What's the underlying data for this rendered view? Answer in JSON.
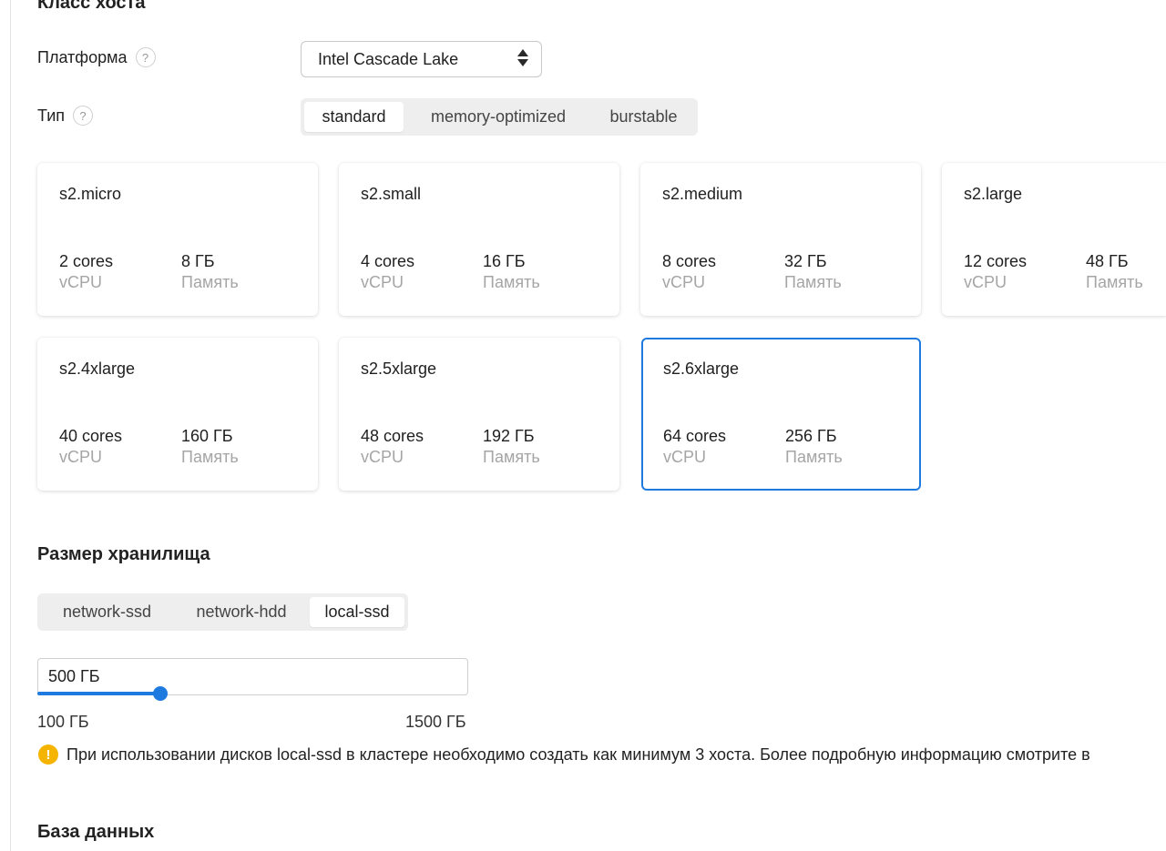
{
  "host_class": {
    "title": "Класс хоста",
    "platform": {
      "label": "Платформа",
      "help": "?",
      "value": "Intel Cascade Lake"
    },
    "type": {
      "label": "Тип",
      "help": "?",
      "options": [
        "standard",
        "memory-optimized",
        "burstable"
      ],
      "selected": "standard"
    },
    "cards": [
      {
        "name": "s2.micro",
        "cores": "2 cores",
        "cores_label": "vCPU",
        "memory": "8 ГБ",
        "memory_label": "Память"
      },
      {
        "name": "s2.small",
        "cores": "4 cores",
        "cores_label": "vCPU",
        "memory": "16 ГБ",
        "memory_label": "Память"
      },
      {
        "name": "s2.medium",
        "cores": "8 cores",
        "cores_label": "vCPU",
        "memory": "32 ГБ",
        "memory_label": "Память"
      },
      {
        "name": "s2.large",
        "cores": "12 cores",
        "cores_label": "vCPU",
        "memory": "48 ГБ",
        "memory_label": "Память"
      },
      {
        "name": "s2.4xlarge",
        "cores": "40 cores",
        "cores_label": "vCPU",
        "memory": "160 ГБ",
        "memory_label": "Память"
      },
      {
        "name": "s2.5xlarge",
        "cores": "48 cores",
        "cores_label": "vCPU",
        "memory": "192 ГБ",
        "memory_label": "Память"
      },
      {
        "name": "s2.6xlarge",
        "cores": "64 cores",
        "cores_label": "vCPU",
        "memory": "256 ГБ",
        "memory_label": "Память"
      }
    ],
    "selected_card": "s2.6xlarge"
  },
  "storage": {
    "title": "Размер хранилища",
    "disk_types": [
      "network-ssd",
      "network-hdd",
      "local-ssd"
    ],
    "selected_disk": "local-ssd",
    "size_value": "500 ГБ",
    "slider_fraction": 0.286,
    "min_label": "100 ГБ",
    "max_label": "1500 ГБ",
    "warning": "При использовании дисков local-ssd в кластере необходимо создать как минимум 3 хоста. Более подробную информацию смотрите в"
  },
  "database": {
    "title": "База данных"
  },
  "colors": {
    "accent": "#1f7ae0",
    "warning": "#f4b400",
    "segment_bg": "#eeeeee",
    "muted_text": "#a5a5a5"
  }
}
